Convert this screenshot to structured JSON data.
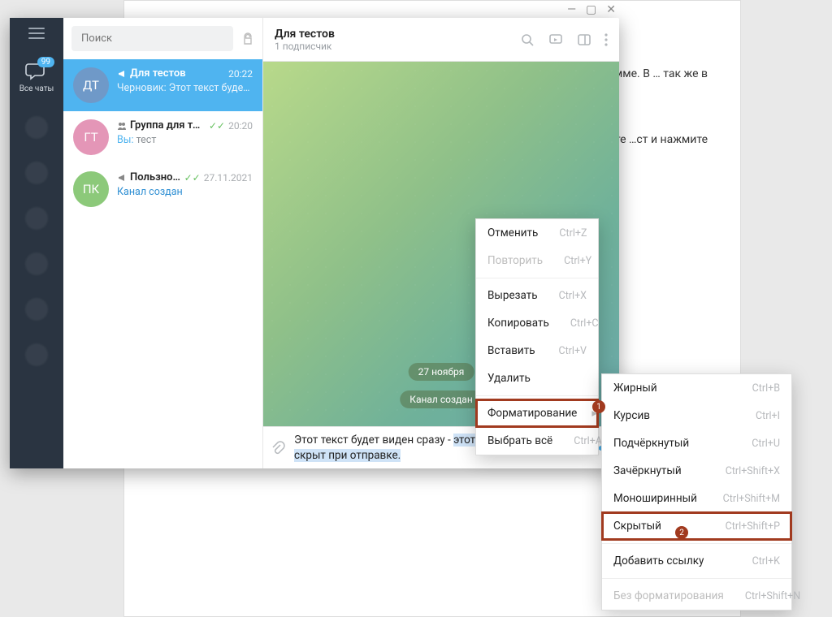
{
  "article": {
    "p1": "…елеграмме. В … так же в",
    "p2": "…напишите …ст и нажмите"
  },
  "titlebar": {
    "min": "—",
    "max": "▢",
    "close": "✕"
  },
  "nav": {
    "badge": "99",
    "all_chats": "Все чаты"
  },
  "search": {
    "placeholder": "Поиск"
  },
  "chats": [
    {
      "initials": "ДТ",
      "color": "#6f99c8",
      "icon": "megaphone",
      "name": "Для тестов",
      "time": "20:22",
      "draft_label": "Черновик:",
      "draft_text": "Этот текст будет …",
      "active": true
    },
    {
      "initials": "ГТ",
      "color": "#e496b7",
      "icon": "group",
      "name": "Группа для те…",
      "ticks": "✓✓",
      "time": "20:20",
      "you": "Вы:",
      "sub": "тест"
    },
    {
      "initials": "ПК",
      "color": "#8cc97a",
      "icon": "megaphone",
      "name": "Пользно…",
      "ticks": "✓✓",
      "time": "27.11.2021",
      "sub_link": "Канал создан"
    }
  ],
  "conv": {
    "title": "Для тестов",
    "subtitle": "1 подписчик",
    "date_pill": "27 ноября",
    "service_pill": "Канал создан",
    "input_visible": "Этот текст будет виден сразу - ",
    "input_selected": "этот текст будет скрыт при отправке."
  },
  "ctx_main": [
    {
      "label": "Отменить",
      "shortcut": "Ctrl+Z"
    },
    {
      "label": "Повторить",
      "shortcut": "Ctrl+Y",
      "disabled": true
    },
    {
      "sep": true
    },
    {
      "label": "Вырезать",
      "shortcut": "Ctrl+X"
    },
    {
      "label": "Копировать",
      "shortcut": "Ctrl+C"
    },
    {
      "label": "Вставить",
      "shortcut": "Ctrl+V"
    },
    {
      "label": "Удалить"
    },
    {
      "sep": true
    },
    {
      "label": "Форматирование",
      "submenu": true,
      "boxed": true
    },
    {
      "label": "Выбрать всё",
      "shortcut": "Ctrl+A"
    }
  ],
  "ctx_fmt": [
    {
      "label": "Жирный",
      "shortcut": "Ctrl+B"
    },
    {
      "label": "Курсив",
      "shortcut": "Ctrl+I"
    },
    {
      "label": "Подчёркнутый",
      "shortcut": "Ctrl+U"
    },
    {
      "label": "Зачёркнутый",
      "shortcut": "Ctrl+Shift+X"
    },
    {
      "label": "Моноширинный",
      "shortcut": "Ctrl+Shift+M"
    },
    {
      "label": "Скрытый",
      "shortcut": "Ctrl+Shift+P",
      "boxed": true
    },
    {
      "sep": true
    },
    {
      "label": "Добавить ссылку",
      "shortcut": "Ctrl+K"
    },
    {
      "sep": true
    },
    {
      "label": "Без форматирования",
      "shortcut": "Ctrl+Shift+N",
      "disabled": true
    }
  ],
  "annot": {
    "n1": "1",
    "n2": "2"
  }
}
